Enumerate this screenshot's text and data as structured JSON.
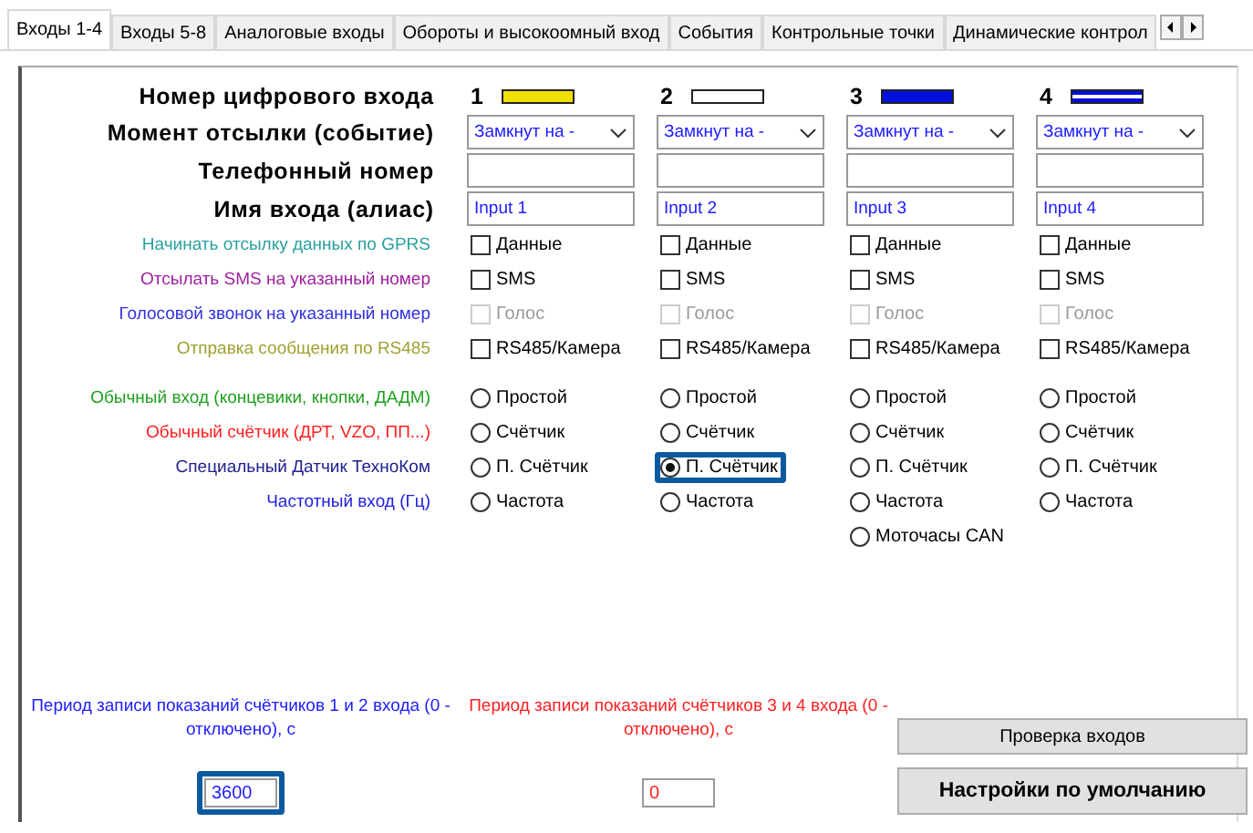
{
  "tabs": [
    {
      "label": "Входы 1-4",
      "selected": true
    },
    {
      "label": "Входы 5-8",
      "selected": false
    },
    {
      "label": "Аналоговые входы",
      "selected": false
    },
    {
      "label": "Обороты и высокоомный вход",
      "selected": false
    },
    {
      "label": "События",
      "selected": false
    },
    {
      "label": "Контрольные точки",
      "selected": false
    },
    {
      "label": "Динамические контрол",
      "selected": false
    }
  ],
  "header_labels": [
    "Номер цифрового входа",
    "Момент отсылки (событие)",
    "Телефонный номер",
    "Имя входа (алиас)"
  ],
  "check_rows": [
    {
      "label": "Начинать отсылку данных по GPRS",
      "color": "#2aa0a0"
    },
    {
      "label": "Отсылать SMS на указанный номер",
      "color": "#a020a0"
    },
    {
      "label": "Голосовой звонок на указанный номер",
      "color": "#3030e0"
    },
    {
      "label": "Отправка сообщения по RS485",
      "color": "#a0a030"
    }
  ],
  "mode_rows": [
    {
      "label": "Обычный вход (концевики, кнопки, ДАДМ)",
      "color": "#20a020"
    },
    {
      "label": "Обычный счётчик (ДРТ, VZO, ПП...)",
      "color": "#ff2020"
    },
    {
      "label": "Специальный Датчик ТехноКом",
      "color": "#202090"
    },
    {
      "label": "Частотный вход (Гц)",
      "color": "#2020e0"
    }
  ],
  "inputs": [
    {
      "number": "1",
      "color": "#f0e000",
      "kind": "solid",
      "event": "Замкнут на -",
      "alias": "Input 1",
      "checks": [
        {
          "label": "Данные",
          "checked": false,
          "disabled": false
        },
        {
          "label": "SMS",
          "checked": false,
          "disabled": false
        },
        {
          "label": "Голос",
          "checked": false,
          "disabled": true
        },
        {
          "label": "RS485/Камера",
          "checked": false,
          "disabled": false
        }
      ],
      "modes": [
        {
          "label": "Простой",
          "selected": false,
          "highlighted": false
        },
        {
          "label": "Счётчик",
          "selected": false,
          "highlighted": false
        },
        {
          "label": "П. Счётчик",
          "selected": false,
          "highlighted": false
        },
        {
          "label": "Частота",
          "selected": false,
          "highlighted": false
        }
      ]
    },
    {
      "number": "2",
      "color": "#ffffff",
      "kind": "solid",
      "event": "Замкнут на -",
      "alias": "Input 2",
      "checks": [
        {
          "label": "Данные",
          "checked": false,
          "disabled": false
        },
        {
          "label": "SMS",
          "checked": false,
          "disabled": false
        },
        {
          "label": "Голос",
          "checked": false,
          "disabled": true
        },
        {
          "label": "RS485/Камера",
          "checked": false,
          "disabled": false
        }
      ],
      "modes": [
        {
          "label": "Простой",
          "selected": false,
          "highlighted": false
        },
        {
          "label": "Счётчик",
          "selected": false,
          "highlighted": false
        },
        {
          "label": "П. Счётчик",
          "selected": true,
          "highlighted": true
        },
        {
          "label": "Частота",
          "selected": false,
          "highlighted": false
        }
      ]
    },
    {
      "number": "3",
      "color": "#0010e0",
      "kind": "solid",
      "event": "Замкнут на -",
      "alias": "Input 3",
      "checks": [
        {
          "label": "Данные",
          "checked": false,
          "disabled": false
        },
        {
          "label": "SMS",
          "checked": false,
          "disabled": false
        },
        {
          "label": "Голос",
          "checked": false,
          "disabled": true
        },
        {
          "label": "RS485/Камера",
          "checked": false,
          "disabled": false
        }
      ],
      "modes": [
        {
          "label": "Простой",
          "selected": false,
          "highlighted": false
        },
        {
          "label": "Счётчик",
          "selected": false,
          "highlighted": false
        },
        {
          "label": "П. Счётчик",
          "selected": false,
          "highlighted": false
        },
        {
          "label": "Частота",
          "selected": false,
          "highlighted": false
        },
        {
          "label": "Моточасы CAN",
          "selected": false,
          "highlighted": false
        }
      ]
    },
    {
      "number": "4",
      "color": "#0010e0",
      "kind": "striped",
      "event": "Замкнут на -",
      "alias": "Input 4",
      "checks": [
        {
          "label": "Данные",
          "checked": false,
          "disabled": false
        },
        {
          "label": "SMS",
          "checked": false,
          "disabled": false
        },
        {
          "label": "Голос",
          "checked": false,
          "disabled": true
        },
        {
          "label": "RS485/Камера",
          "checked": false,
          "disabled": false
        }
      ],
      "modes": [
        {
          "label": "Простой",
          "selected": false,
          "highlighted": false
        },
        {
          "label": "Счётчик",
          "selected": false,
          "highlighted": false
        },
        {
          "label": "П. Счётчик",
          "selected": false,
          "highlighted": false
        },
        {
          "label": "Частота",
          "selected": false,
          "highlighted": false
        }
      ]
    }
  ],
  "periods": [
    {
      "label": "Период записи показаний счётчиков 1 и 2 входа (0 - отключено), с",
      "value": "3600",
      "color": "#2020ff",
      "highlighted": true
    },
    {
      "label": "Период записи показаний счётчиков 3 и 4 входа (0 - отключено), с",
      "value": "0",
      "color": "#ff2020",
      "highlighted": false
    }
  ],
  "buttons": [
    {
      "label": "Проверка входов",
      "kind": "normal"
    },
    {
      "label": "Настройки по умолчанию",
      "kind": "bold"
    }
  ]
}
